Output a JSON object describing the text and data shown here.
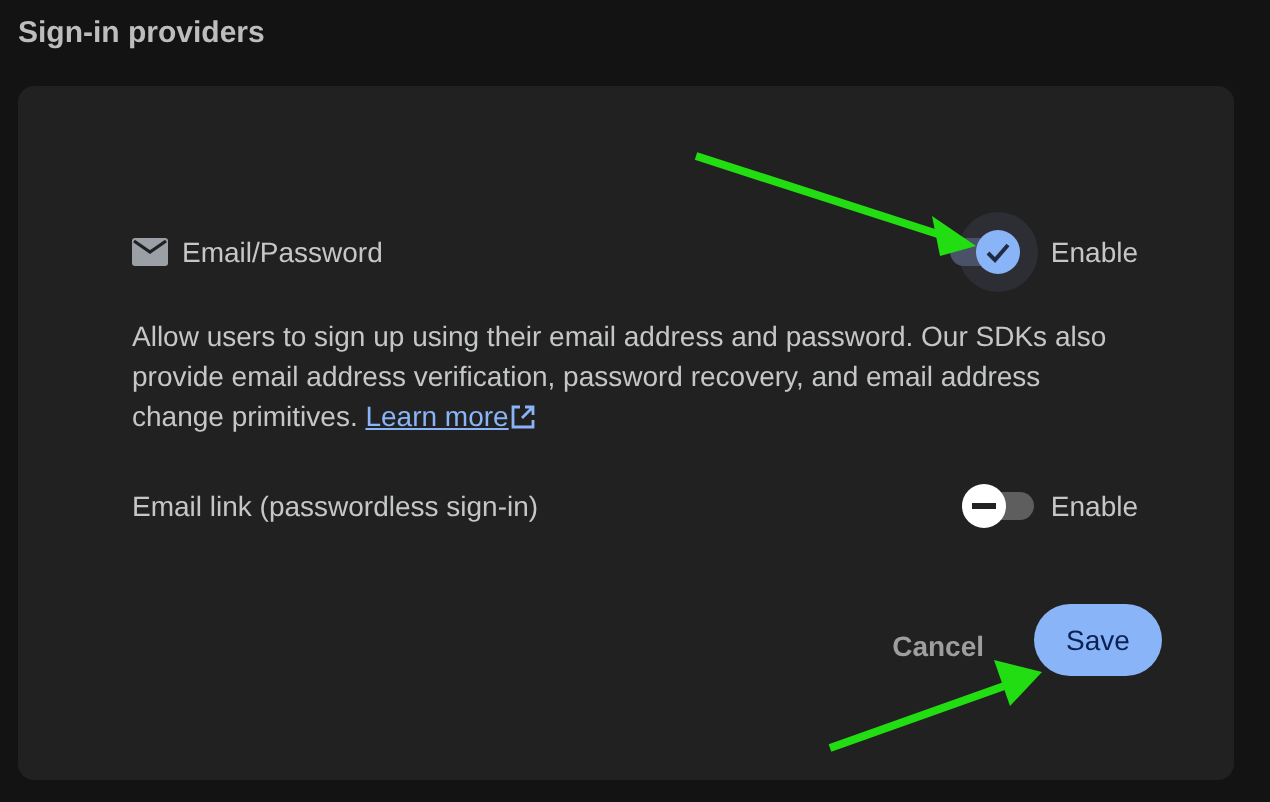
{
  "section_title": "Sign-in providers",
  "email_password": {
    "label": "Email/Password",
    "enabled": true,
    "toggle_label": "Enable",
    "description": "Allow users to sign up using their email address and password. Our SDKs also provide email address verification, password recovery, and email address change primitives.",
    "learn_more": "Learn more"
  },
  "email_link": {
    "label": "Email link (passwordless sign-in)",
    "enabled": false,
    "toggle_label": "Enable"
  },
  "buttons": [
    {
      "label": "Cancel",
      "kind": "text"
    },
    {
      "label": "Save",
      "kind": "filled"
    }
  ]
}
